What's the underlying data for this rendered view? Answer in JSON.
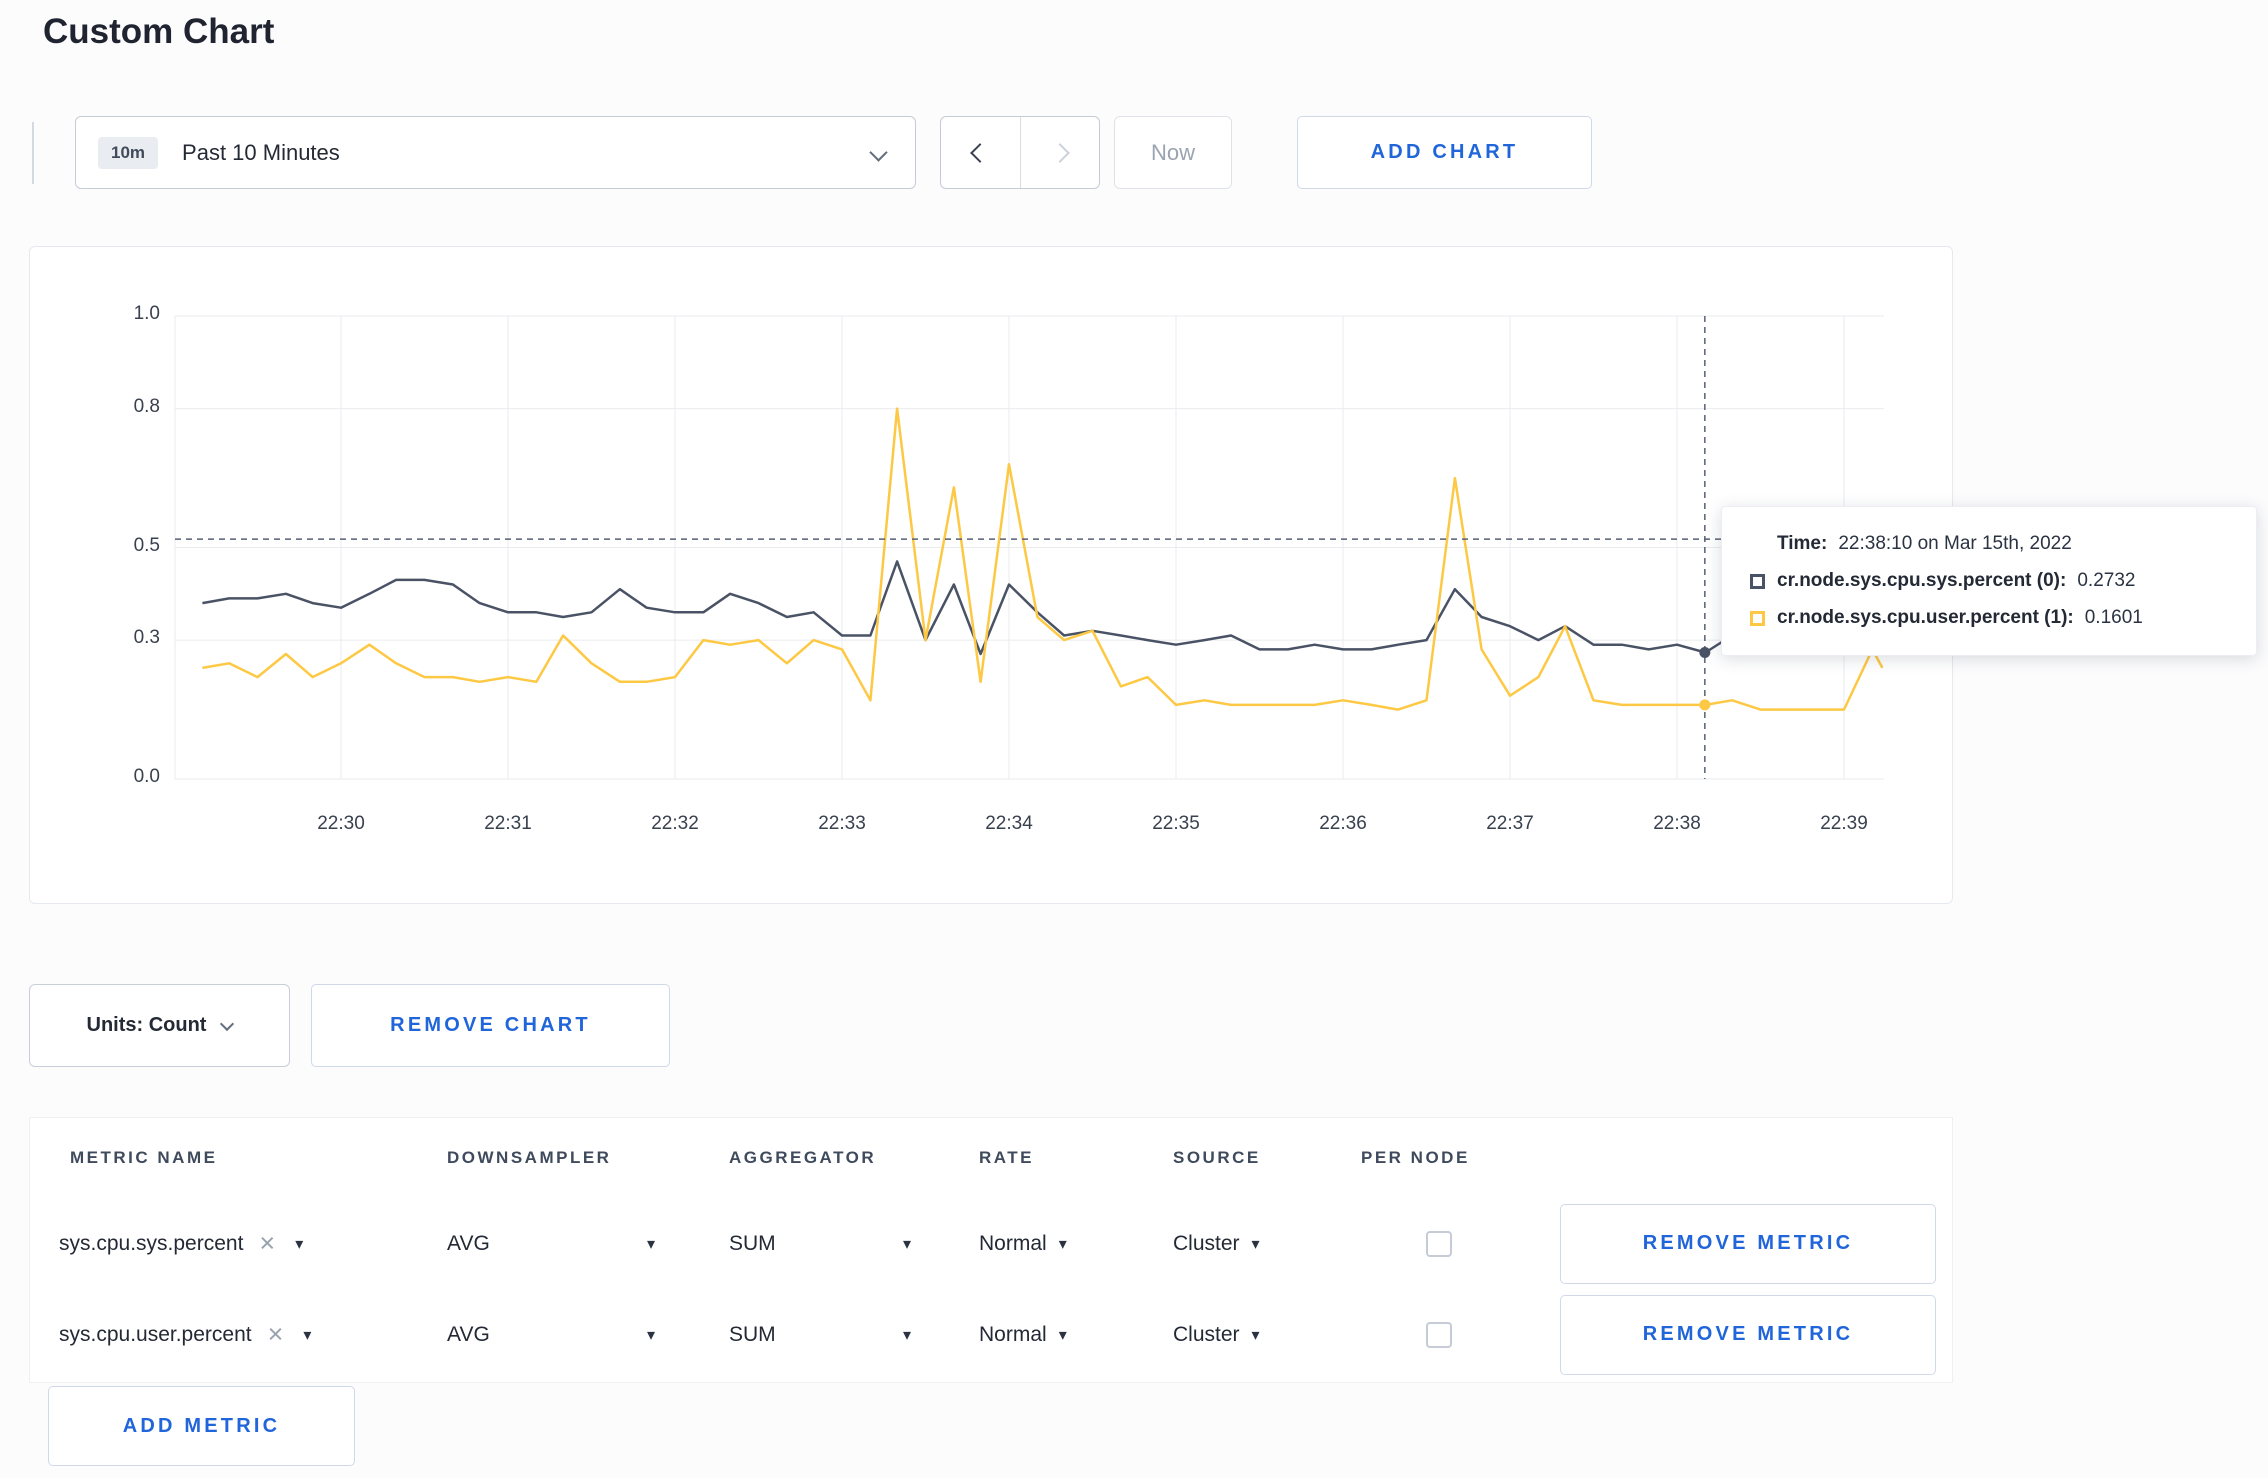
{
  "page": {
    "title": "Custom Chart"
  },
  "toolbar": {
    "time_badge": "10m",
    "time_label": "Past 10 Minutes",
    "now_label": "Now",
    "add_chart_label": "ADD CHART"
  },
  "chart_controls": {
    "units_label": "Units: Count",
    "remove_chart_label": "REMOVE CHART"
  },
  "tooltip": {
    "time_label": "Time:",
    "time_value": "22:38:10 on Mar 15th, 2022",
    "series": [
      {
        "label": "cr.node.sys.cpu.sys.percent (0):",
        "value": "0.2732"
      },
      {
        "label": "cr.node.sys.cpu.user.percent (1):",
        "value": "0.1601"
      }
    ]
  },
  "metrics_table": {
    "headers": [
      "METRIC NAME",
      "DOWNSAMPLER",
      "AGGREGATOR",
      "RATE",
      "SOURCE",
      "PER NODE"
    ],
    "rows": [
      {
        "name": "sys.cpu.sys.percent",
        "downsampler": "AVG",
        "aggregator": "SUM",
        "rate": "Normal",
        "source": "Cluster",
        "per_node_checked": false,
        "remove_label": "REMOVE METRIC"
      },
      {
        "name": "sys.cpu.user.percent",
        "downsampler": "AVG",
        "aggregator": "SUM",
        "rate": "Normal",
        "source": "Cluster",
        "per_node_checked": false,
        "remove_label": "REMOVE METRIC"
      }
    ],
    "add_metric_label": "ADD METRIC"
  },
  "colors": {
    "accent_blue": "#2065d9",
    "series_sys": "#4a5365",
    "series_user": "#fdc843"
  },
  "chart_data": {
    "type": "line",
    "title": "",
    "x_axis": "time HH:MM on Mar 15th 2022, minutes offset from 22:30",
    "ylim": [
      0,
      1
    ],
    "xlim": [
      -1,
      9.35
    ],
    "grid": true,
    "y_ticks": [
      {
        "v": 0,
        "label": "0.0"
      },
      {
        "v": 0.3,
        "label": "0.3"
      },
      {
        "v": 0.5,
        "label": "0.5"
      },
      {
        "v": 0.8,
        "label": "0.8"
      },
      {
        "v": 1,
        "label": "1.0"
      }
    ],
    "x_ticks": [
      {
        "t": 0,
        "label": "22:30"
      },
      {
        "t": 1,
        "label": "22:31"
      },
      {
        "t": 2,
        "label": "22:32"
      },
      {
        "t": 3,
        "label": "22:33"
      },
      {
        "t": 4,
        "label": "22:34"
      },
      {
        "t": 5,
        "label": "22:35"
      },
      {
        "t": 6,
        "label": "22:36"
      },
      {
        "t": 7,
        "label": "22:37"
      },
      {
        "t": 8,
        "label": "22:38"
      },
      {
        "t": 9,
        "label": "22:39"
      }
    ],
    "series": [
      {
        "name": "cr.node.sys.cpu.sys.percent",
        "color": "#4a5365",
        "points": [
          [
            -0.83,
            0.38
          ],
          [
            -0.67,
            0.39
          ],
          [
            -0.5,
            0.39
          ],
          [
            -0.33,
            0.4
          ],
          [
            -0.17,
            0.38
          ],
          [
            0,
            0.37
          ],
          [
            0.17,
            0.4
          ],
          [
            0.33,
            0.43
          ],
          [
            0.5,
            0.43
          ],
          [
            0.67,
            0.42
          ],
          [
            0.83,
            0.38
          ],
          [
            1,
            0.36
          ],
          [
            1.17,
            0.36
          ],
          [
            1.33,
            0.35
          ],
          [
            1.5,
            0.36
          ],
          [
            1.67,
            0.41
          ],
          [
            1.83,
            0.37
          ],
          [
            2,
            0.36
          ],
          [
            2.17,
            0.36
          ],
          [
            2.33,
            0.4
          ],
          [
            2.5,
            0.38
          ],
          [
            2.67,
            0.35
          ],
          [
            2.83,
            0.36
          ],
          [
            3,
            0.31
          ],
          [
            3.17,
            0.31
          ],
          [
            3.33,
            0.47
          ],
          [
            3.5,
            0.3
          ],
          [
            3.67,
            0.42
          ],
          [
            3.83,
            0.27
          ],
          [
            4,
            0.42
          ],
          [
            4.17,
            0.36
          ],
          [
            4.33,
            0.31
          ],
          [
            4.5,
            0.32
          ],
          [
            4.67,
            0.31
          ],
          [
            4.83,
            0.3
          ],
          [
            5,
            0.29
          ],
          [
            5.17,
            0.3
          ],
          [
            5.33,
            0.31
          ],
          [
            5.5,
            0.28
          ],
          [
            5.67,
            0.28
          ],
          [
            5.83,
            0.29
          ],
          [
            6,
            0.28
          ],
          [
            6.17,
            0.28
          ],
          [
            6.33,
            0.29
          ],
          [
            6.5,
            0.3
          ],
          [
            6.67,
            0.41
          ],
          [
            6.83,
            0.35
          ],
          [
            7,
            0.33
          ],
          [
            7.17,
            0.3
          ],
          [
            7.33,
            0.33
          ],
          [
            7.5,
            0.29
          ],
          [
            7.67,
            0.29
          ],
          [
            7.83,
            0.28
          ],
          [
            8,
            0.29
          ],
          [
            8.17,
            0.2732
          ],
          [
            8.33,
            0.31
          ],
          [
            8.5,
            0.32
          ],
          [
            8.67,
            0.3
          ],
          [
            8.83,
            0.3
          ],
          [
            9,
            0.3
          ],
          [
            9.17,
            0.31
          ],
          [
            9.23,
            0.3
          ]
        ]
      },
      {
        "name": "cr.node.sys.cpu.user.percent",
        "color": "#fdc843",
        "points": [
          [
            -0.83,
            0.24
          ],
          [
            -0.67,
            0.25
          ],
          [
            -0.5,
            0.22
          ],
          [
            -0.33,
            0.27
          ],
          [
            -0.17,
            0.22
          ],
          [
            0,
            0.25
          ],
          [
            0.17,
            0.29
          ],
          [
            0.33,
            0.25
          ],
          [
            0.5,
            0.22
          ],
          [
            0.67,
            0.22
          ],
          [
            0.83,
            0.21
          ],
          [
            1,
            0.22
          ],
          [
            1.17,
            0.21
          ],
          [
            1.33,
            0.31
          ],
          [
            1.5,
            0.25
          ],
          [
            1.67,
            0.21
          ],
          [
            1.83,
            0.21
          ],
          [
            2,
            0.22
          ],
          [
            2.17,
            0.3
          ],
          [
            2.33,
            0.29
          ],
          [
            2.5,
            0.3
          ],
          [
            2.67,
            0.25
          ],
          [
            2.83,
            0.3
          ],
          [
            3,
            0.28
          ],
          [
            3.17,
            0.17
          ],
          [
            3.33,
            0.8
          ],
          [
            3.5,
            0.3
          ],
          [
            3.67,
            0.63
          ],
          [
            3.83,
            0.21
          ],
          [
            4,
            0.68
          ],
          [
            4.17,
            0.35
          ],
          [
            4.33,
            0.3
          ],
          [
            4.5,
            0.32
          ],
          [
            4.67,
            0.2
          ],
          [
            4.83,
            0.22
          ],
          [
            5,
            0.16
          ],
          [
            5.17,
            0.17
          ],
          [
            5.33,
            0.16
          ],
          [
            5.5,
            0.16
          ],
          [
            5.67,
            0.16
          ],
          [
            5.83,
            0.16
          ],
          [
            6,
            0.17
          ],
          [
            6.17,
            0.16
          ],
          [
            6.33,
            0.15
          ],
          [
            6.5,
            0.17
          ],
          [
            6.67,
            0.65
          ],
          [
            6.83,
            0.28
          ],
          [
            7,
            0.18
          ],
          [
            7.17,
            0.22
          ],
          [
            7.33,
            0.33
          ],
          [
            7.5,
            0.17
          ],
          [
            7.67,
            0.16
          ],
          [
            7.83,
            0.16
          ],
          [
            8,
            0.16
          ],
          [
            8.17,
            0.1601
          ],
          [
            8.33,
            0.17
          ],
          [
            8.5,
            0.15
          ],
          [
            8.67,
            0.15
          ],
          [
            8.83,
            0.15
          ],
          [
            9,
            0.15
          ],
          [
            9.17,
            0.28
          ],
          [
            9.23,
            0.24
          ]
        ]
      }
    ],
    "crosshair": {
      "t": 8.1667,
      "time": "22:38:10",
      "hline_value": 0.518,
      "markers": [
        {
          "series": 0,
          "v": 0.2732
        },
        {
          "series": 1,
          "v": 0.1601
        }
      ]
    }
  }
}
